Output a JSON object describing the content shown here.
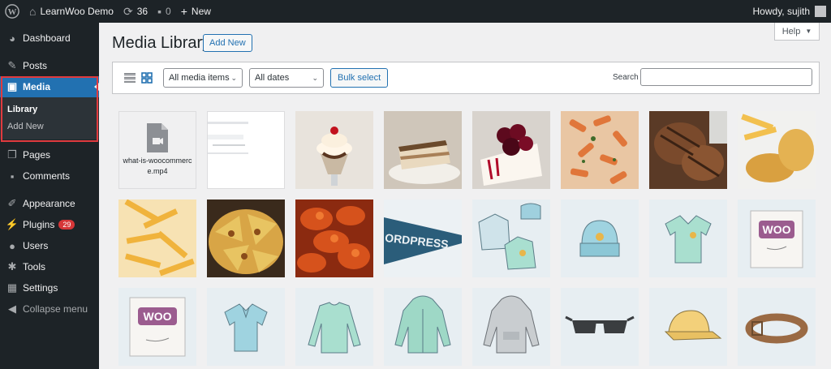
{
  "admin_bar": {
    "site_name": "LearnWoo Demo",
    "updates_count": "36",
    "comments_count": "0",
    "new_label": "New",
    "howdy": "Howdy, sujith"
  },
  "sidebar": {
    "items": [
      {
        "label": "Dashboard",
        "icon": "dashboard-icon"
      },
      {
        "label": "Posts",
        "icon": "pin-icon"
      },
      {
        "label": "Media",
        "icon": "media-icon"
      },
      {
        "label": "Pages",
        "icon": "pages-icon"
      },
      {
        "label": "Comments",
        "icon": "comments-icon"
      },
      {
        "label": "Appearance",
        "icon": "appearance-icon"
      },
      {
        "label": "Plugins",
        "icon": "plugins-icon",
        "badge": "29"
      },
      {
        "label": "Users",
        "icon": "users-icon"
      },
      {
        "label": "Tools",
        "icon": "tools-icon"
      },
      {
        "label": "Settings",
        "icon": "settings-icon"
      },
      {
        "label": "Collapse menu",
        "icon": "collapse-icon"
      }
    ],
    "media_submenu": [
      "Library",
      "Add New"
    ]
  },
  "main": {
    "title": "Media Library",
    "add_new": "Add New",
    "help": "Help",
    "filter_type": "All media items",
    "filter_date": "All dates",
    "bulk_select": "Bulk select",
    "search_label": "Search",
    "search_value": ""
  },
  "media": {
    "doc_file_name": "what-is-woocommerce.mp4",
    "items": [
      "video-file",
      "document-screenshot",
      "ice-cream-sundae",
      "tiramisu",
      "cherry-cheesecake",
      "penne-pasta",
      "grilled-steak",
      "fries-and-fish",
      "french-fries",
      "nachos",
      "chicken-wings",
      "wordpress-pennant",
      "hoodie-and-shirts",
      "beanie",
      "v-neck-tshirt",
      "woo-poster",
      "woo-album",
      "polo-shirt",
      "long-sleeve-shirt",
      "hoodie-with-zipper",
      "hoodie-gray",
      "sunglasses",
      "cap",
      "belt"
    ]
  }
}
